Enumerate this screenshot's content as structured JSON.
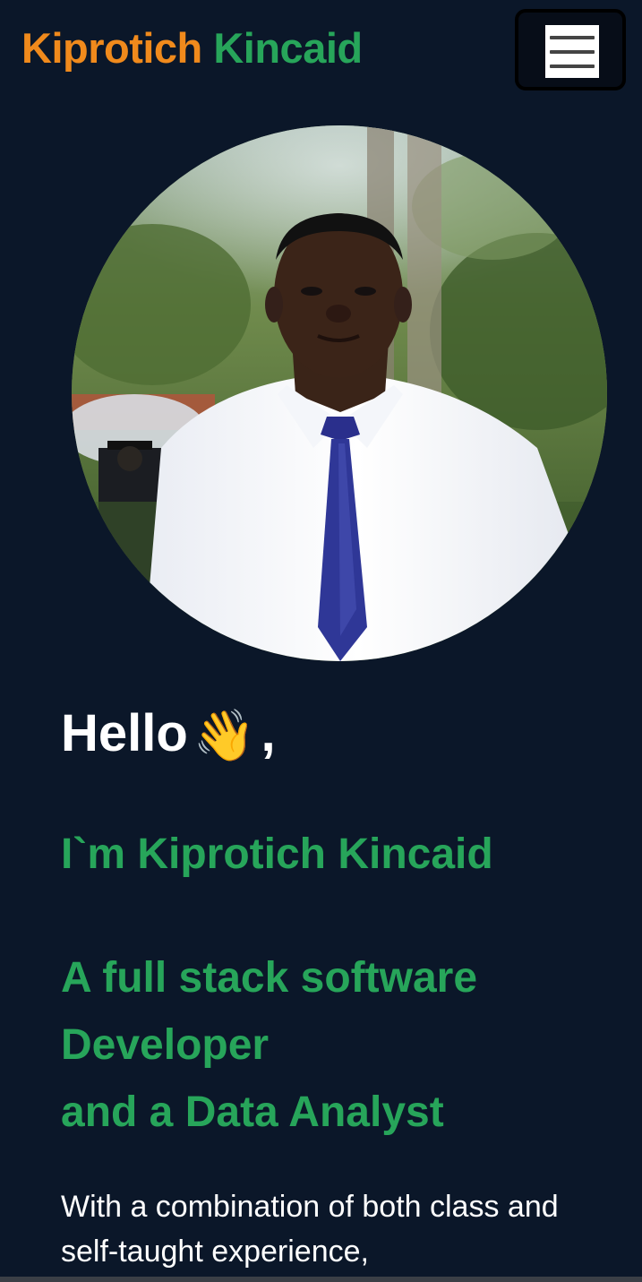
{
  "header": {
    "brand_first": "Kiprotich",
    "brand_last": "Kincaid",
    "menu_icon": "hamburger-menu-icon"
  },
  "hero": {
    "hello": "Hello",
    "wave_emoji": "👋",
    "hello_suffix": ",",
    "intro": "I`m Kiprotich Kincaid",
    "role_line1": "A full stack software",
    "role_line2": "Developer",
    "role_line3": "and a Data Analyst",
    "desc_line1": "With a combination of both class and",
    "desc_line2": "self-taught experience,"
  },
  "colors": {
    "background": "#0b1729",
    "brand_orange": "#f08a1c",
    "brand_green": "#27a55a",
    "text_white": "#ffffff"
  }
}
